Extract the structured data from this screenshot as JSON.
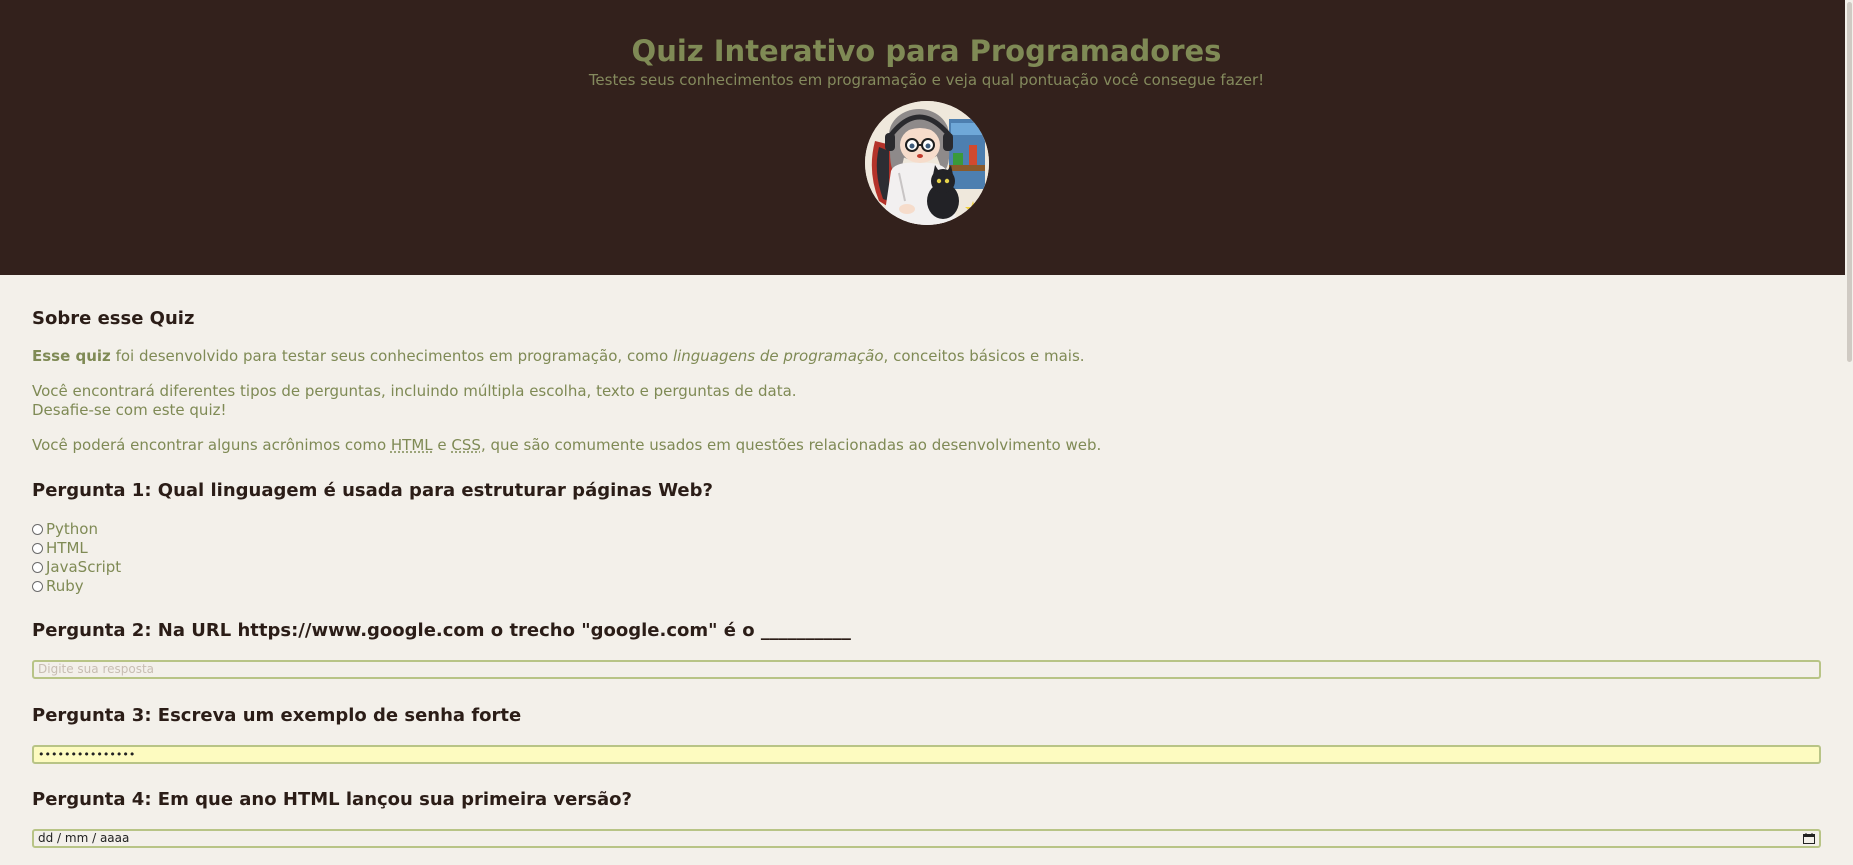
{
  "header": {
    "title": "Quiz Interativo para Programadores",
    "subtitle": "Testes seus conhecimentos em programação e veja qual pontuação você consegue fazer!"
  },
  "about": {
    "heading": "Sobre esse Quiz",
    "p1_strong": "Esse quiz",
    "p1_mid": " foi desenvolvido para testar seus conhecimentos em programação, como ",
    "p1_em": "linguagens de programação",
    "p1_end": ", conceitos básicos e mais.",
    "p2_line1": "Você encontrará diferentes tipos de perguntas, incluindo múltipla escolha, texto e perguntas de data.",
    "p2_line2": "Desafie-se com este quiz!",
    "p3_start": "Você poderá encontrar alguns acrônimos como ",
    "p3_abbr1": "HTML",
    "p3_and": " e ",
    "p3_abbr2": "CSS",
    "p3_end": ", que são comumente usados em questões relacionadas ao desenvolvimento web."
  },
  "questions": {
    "q1": {
      "heading": "Pergunta 1: Qual linguagem é usada para estruturar páginas Web?",
      "options": [
        "Python",
        "HTML",
        "JavaScript",
        "Ruby"
      ]
    },
    "q2": {
      "heading": "Pergunta 2: Na URL https://www.google.com o trecho \"google.com\" é o __________",
      "placeholder": "Digite sua resposta"
    },
    "q3": {
      "heading": "Pergunta 3: Escreva um exemplo de senha forte",
      "value": "•••••••••••••••"
    },
    "q4": {
      "heading": "Pergunta 4: Em que ano HTML lançou sua primeira versão?",
      "date_placeholder": "dd / mm / aaaa"
    }
  },
  "colors": {
    "header_bg": "#33211c",
    "page_bg": "#f3f0ea",
    "accent_olive": "#7f8a55",
    "heading_dark": "#2b1d17",
    "input_border": "#b8c486",
    "autofill_yellow": "#fdfbc0"
  },
  "icons": {
    "date_picker": "calendar-icon",
    "avatar": "pixel-art-programmer-avatar"
  }
}
